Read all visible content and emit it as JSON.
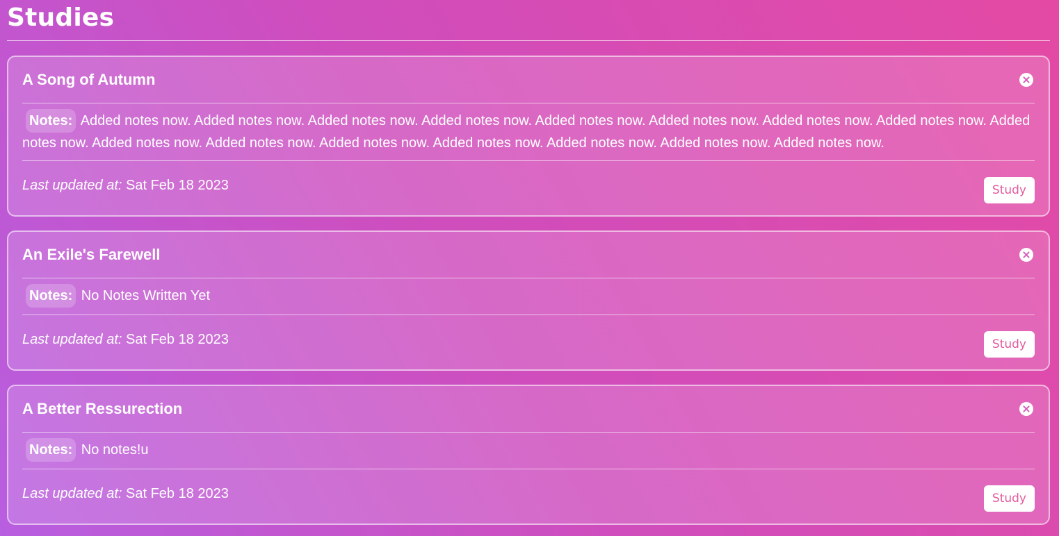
{
  "page": {
    "title": "Studies"
  },
  "labels": {
    "notes": "Notes:",
    "last_updated": "Last updated at:",
    "study_button": "Study"
  },
  "studies": [
    {
      "title": "A Song of Autumn",
      "notes": "Added notes now. Added notes now. Added notes now. Added notes now. Added notes now. Added notes now. Added notes now. Added notes now. Added notes now. Added notes now. Added notes now. Added notes now. Added notes now. Added notes now. Added notes now. Added notes now.",
      "updated": "Sat Feb 18 2023"
    },
    {
      "title": "An Exile's Farewell",
      "notes": "No Notes Written Yet",
      "updated": "Sat Feb 18 2023"
    },
    {
      "title": "A Better Ressurection",
      "notes": "No notes!u",
      "updated": "Sat Feb 18 2023"
    }
  ],
  "icons": {
    "close": "close-icon"
  },
  "colors": {
    "accent": "#e35a9e",
    "gradient_start": "#b75ee0",
    "gradient_end": "#e44aa4"
  }
}
